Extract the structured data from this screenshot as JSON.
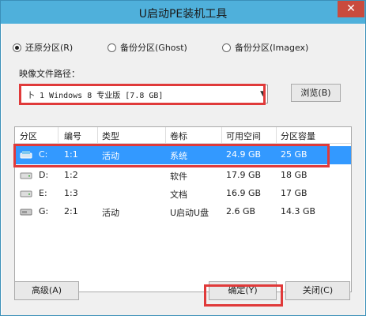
{
  "window": {
    "title": "U启动PE装机工具",
    "close": "✕"
  },
  "modes": [
    {
      "label": "还原分区(R)",
      "selected": true
    },
    {
      "label": "备份分区(Ghost)",
      "selected": false
    },
    {
      "label": "备份分区(Imagex)",
      "selected": false
    }
  ],
  "image_path": {
    "label": "映像文件路径：",
    "value": "卜 1 Windows 8 专业版 [7.8 GB]",
    "browse_label": "浏览(B)"
  },
  "table": {
    "columns": [
      "分区",
      "编号",
      "类型",
      "卷标",
      "可用空间",
      "分区容量"
    ],
    "rows": [
      {
        "drive": "C:",
        "num": "1:1",
        "type": "活动",
        "label": "系统",
        "free": "24.9 GB",
        "size": "25 GB",
        "selected": true,
        "icon": "system-drive-icon"
      },
      {
        "drive": "D:",
        "num": "1:2",
        "type": "",
        "label": "软件",
        "free": "17.9 GB",
        "size": "18 GB",
        "selected": false,
        "icon": "hard-drive-icon"
      },
      {
        "drive": "E:",
        "num": "1:3",
        "type": "",
        "label": "文档",
        "free": "16.9 GB",
        "size": "17 GB",
        "selected": false,
        "icon": "hard-drive-icon"
      },
      {
        "drive": "G:",
        "num": "2:1",
        "type": "活动",
        "label": "U启动U盘",
        "free": "2.6 GB",
        "size": "14.3 GB",
        "selected": false,
        "icon": "usb-drive-icon"
      }
    ]
  },
  "buttons": {
    "advanced": "高级(A)",
    "ok": "确定(Y)",
    "close": "关闭(C)"
  },
  "colors": {
    "titlebar": "#4fb0db",
    "selection": "#3399ff",
    "highlight_box": "#e03a3a"
  }
}
